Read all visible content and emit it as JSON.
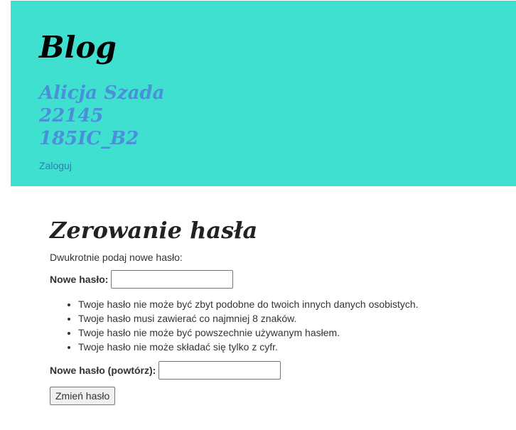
{
  "header": {
    "title": "Blog",
    "author_lines": [
      "Alicja Szada",
      "22145",
      "185IC_B2"
    ],
    "login_link": "Zaloguj"
  },
  "form": {
    "heading": "Zerowanie hasła",
    "intro": "Dwukrotnie podaj nowe hasło:",
    "new_password_label": "Nowe hasło:",
    "new_password_value": "",
    "rules": [
      "Twoje hasło nie może być zbyt podobne do twoich innych danych osobistych.",
      "Twoje hasło musi zawierać co najmniej 8 znaków.",
      "Twoje hasło nie może być powszechnie używanym hasłem.",
      "Twoje hasło nie może składać się tylko z cyfr."
    ],
    "confirm_password_label": "Nowe hasło (powtórz):",
    "confirm_password_value": "",
    "submit_label": "Zmień hasło"
  },
  "colors": {
    "header_background": "#40e0d0",
    "author_text": "#4a90d9",
    "link": "#337ab7"
  }
}
